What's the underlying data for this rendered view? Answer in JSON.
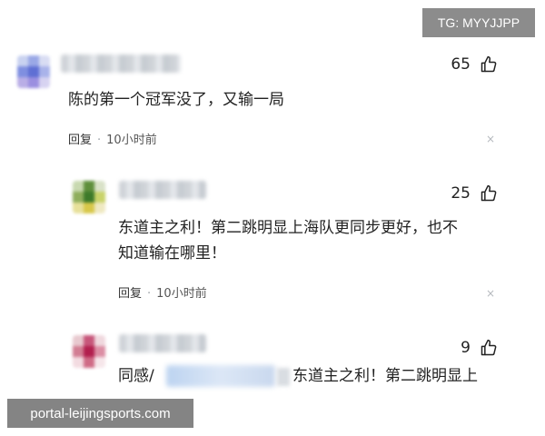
{
  "watermark_top": "TG: MYYJJPP",
  "watermark_bottom": "portal-leijingsports.com",
  "comments": [
    {
      "likes": "65",
      "text_lines": [
        "陈的第一个冠军没了，又输一局"
      ],
      "reply_label": "回复",
      "time": "10小时前",
      "close_icon": "×"
    },
    {
      "likes": "25",
      "text_lines": [
        "东道主之利！第二跳明显上海队更同步更好，也不",
        "知道输在哪里！"
      ],
      "reply_label": "回复",
      "time": "10小时前",
      "close_icon": "×"
    },
    {
      "likes": "9",
      "text_prefix": "同感/",
      "text_suffix": "东道主之利！第二跳明显上"
    }
  ],
  "icons": {
    "like": "thumbs-up-icon",
    "close": "close-icon"
  },
  "colors": {
    "text": "#222222",
    "meta": "#555555",
    "close": "#b5b9be",
    "watermark_bg": "#787878"
  }
}
